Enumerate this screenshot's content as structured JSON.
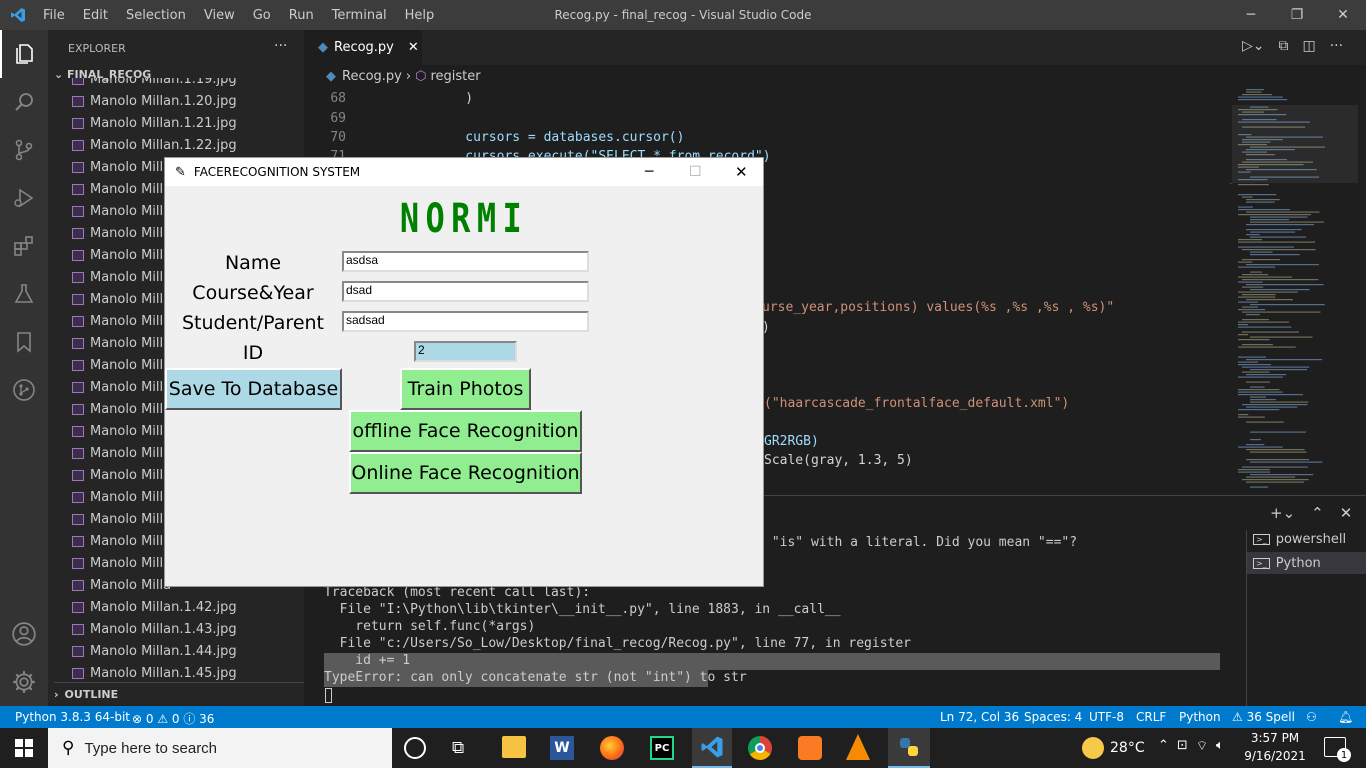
{
  "titlebar": {
    "menu": [
      "File",
      "Edit",
      "Selection",
      "View",
      "Go",
      "Run",
      "Terminal",
      "Help"
    ],
    "title": "Recog.py - final_recog - Visual Studio Code"
  },
  "sidebar": {
    "header": "EXPLORER",
    "project": "FINAL_RECOG",
    "files": [
      "Manolo Millan.1.19.jpg",
      "Manolo Millan.1.20.jpg",
      "Manolo Millan.1.21.jpg",
      "Manolo Millan.1.22.jpg",
      "Manolo Milla",
      "Manolo Milla",
      "Manolo Milla",
      "Manolo Milla",
      "Manolo Milla",
      "Manolo Milla",
      "Manolo Milla",
      "Manolo Milla",
      "Manolo Milla",
      "Manolo Milla",
      "Manolo Milla",
      "Manolo Milla",
      "Manolo Milla",
      "Manolo Milla",
      "Manolo Milla",
      "Manolo Milla",
      "Manolo Milla",
      "Manolo Milla",
      "Manolo Milla",
      "Manolo Milla",
      "Manolo Millan.1.42.jpg",
      "Manolo Millan.1.43.jpg",
      "Manolo Millan.1.44.jpg",
      "Manolo Millan.1.45.jpg",
      "Manolo Millan.1.46.jpg"
    ],
    "outline": "OUTLINE"
  },
  "editor": {
    "tab": "Recog.py",
    "breadcrumb_file": "Recog.py",
    "breadcrumb_symbol": "register",
    "lines": [
      {
        "n": "68",
        "t": "    )"
      },
      {
        "n": "69",
        "t": ""
      },
      {
        "n": "70",
        "t": "    cursors = databases.cursor()"
      },
      {
        "n": "71",
        "t": "    cursors.execute(\"SELECT * from record\")"
      }
    ],
    "fragments": [
      "urse_year,positions) values(%s ,%s ,%s , %s)\"",
      ")",
      "(\"haarcascade_frontalface_default.xml\")",
      "GR2RGB)",
      "Scale(gray, 1.3, 5)"
    ]
  },
  "terminal": {
    "warning": " \"is\" with a literal. Did you mean \"==\"?",
    "lines": [
      "Traceback (most recent call last):",
      "  File \"I:\\Python\\lib\\tkinter\\__init__.py\", line 1883, in __call__",
      "    return self.func(*args)",
      "  File \"c:/Users/So_Low/Desktop/final_recog/Recog.py\", line 77, in register",
      "    id += 1",
      "TypeError: can only concatenate str (not \"int\") to str"
    ],
    "shells": [
      "powershell",
      "Python"
    ]
  },
  "statusbar": {
    "python": "Python 3.8.3 64-bit",
    "problems": "⊗ 0 ⚠ 0 ⓘ 36",
    "position": "Ln 72, Col 36",
    "spaces": "Spaces: 4",
    "encoding": "UTF-8",
    "eol": "CRLF",
    "language": "Python",
    "spell": "⚠ 36 Spell"
  },
  "taskbar": {
    "search_placeholder": "Type here to search",
    "weather": "28°C",
    "time": "3:57 PM",
    "date": "9/16/2021",
    "notifications": "1"
  },
  "tk": {
    "title": "FACERECOGNITION SYSTEM",
    "logo": "NORMI",
    "labels": {
      "name": "Name",
      "course": "Course&Year",
      "student": "Student/Parent",
      "id": "ID"
    },
    "values": {
      "name": "asdsa",
      "course": "dsad",
      "student": "sadsad",
      "id": "2"
    },
    "buttons": {
      "save": "Save To Database",
      "train": "Train Photos",
      "offline": "offline Face Recognition",
      "online": "Online Face Recognition"
    }
  },
  "colors": {
    "accent": "#007acc",
    "button_green": "#90ee90",
    "button_blue": "#add8e6",
    "logo_green": "#008000"
  }
}
